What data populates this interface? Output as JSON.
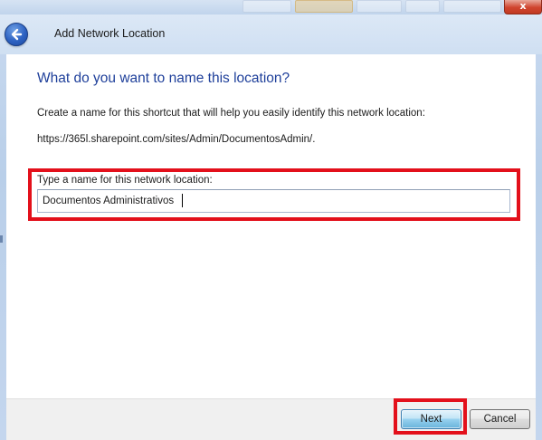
{
  "window": {
    "title": "Add Network Location",
    "close_label": "x"
  },
  "page": {
    "heading": "What do you want to name this location?",
    "description": "Create a name for this shortcut that will help you easily identify this network location:",
    "url": "https://365l.sharepoint.com/sites/Admin/DocumentosAdmin/."
  },
  "name_field": {
    "label": "Type a name for this network location:",
    "value": "Documentos Administrativos"
  },
  "buttons": {
    "next": "Next",
    "cancel": "Cancel"
  },
  "colors": {
    "highlight": "#e3101b",
    "heading": "#1e3f9a",
    "back_button": "#2d62c2"
  },
  "icons": {
    "back": "back-arrow-icon"
  }
}
